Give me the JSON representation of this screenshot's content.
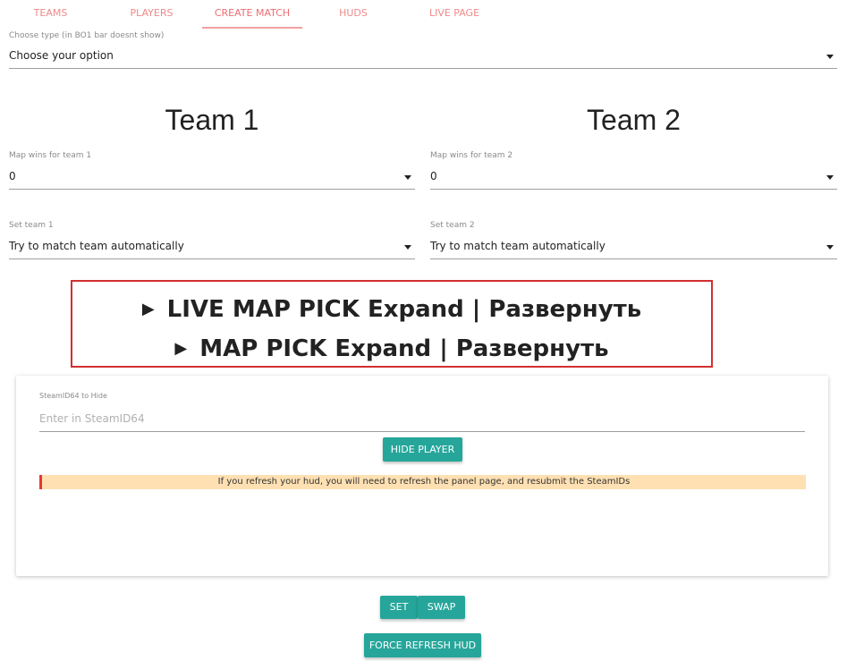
{
  "tabs": [
    {
      "label": "TEAMS"
    },
    {
      "label": "PLAYERS"
    },
    {
      "label": "CREATE MATCH"
    },
    {
      "label": "HUDS"
    },
    {
      "label": "LIVE PAGE"
    }
  ],
  "type_select": {
    "label": "Choose type (in BO1 bar doesnt show)",
    "value": "Choose your option"
  },
  "team1": {
    "title": "Team 1",
    "map_wins_label": "Map wins for team 1",
    "map_wins_value": "0",
    "set_team_label": "Set team 1",
    "set_team_value": "Try to match team automatically"
  },
  "team2": {
    "title": "Team 2",
    "map_wins_label": "Map wins for team 2",
    "map_wins_value": "0",
    "set_team_label": "Set team 2",
    "set_team_value": "Try to match team automatically"
  },
  "map_pick": {
    "live_label": "LIVE MAP PICK Expand | Развернуть",
    "pick_label": "MAP PICK Expand | Развернуть",
    "expand_glyph": "▶"
  },
  "hide_player": {
    "label": "SteamID64 to Hide",
    "placeholder": "Enter in SteamID64",
    "button": "HIDE PLAYER",
    "warning": "If you refresh your hud, you will need to refresh the panel page, and resubmit the SteamIDs"
  },
  "actions": {
    "set": "SET",
    "swap": "SWAP",
    "force_refresh": "FORCE REFRESH HUD"
  },
  "colors": {
    "accent": "#26a69a",
    "tab_text": "#ee6e73",
    "warning_bg": "#ffe0b2",
    "warning_border": "#e53935",
    "highlight_box": "#d32f2f"
  }
}
